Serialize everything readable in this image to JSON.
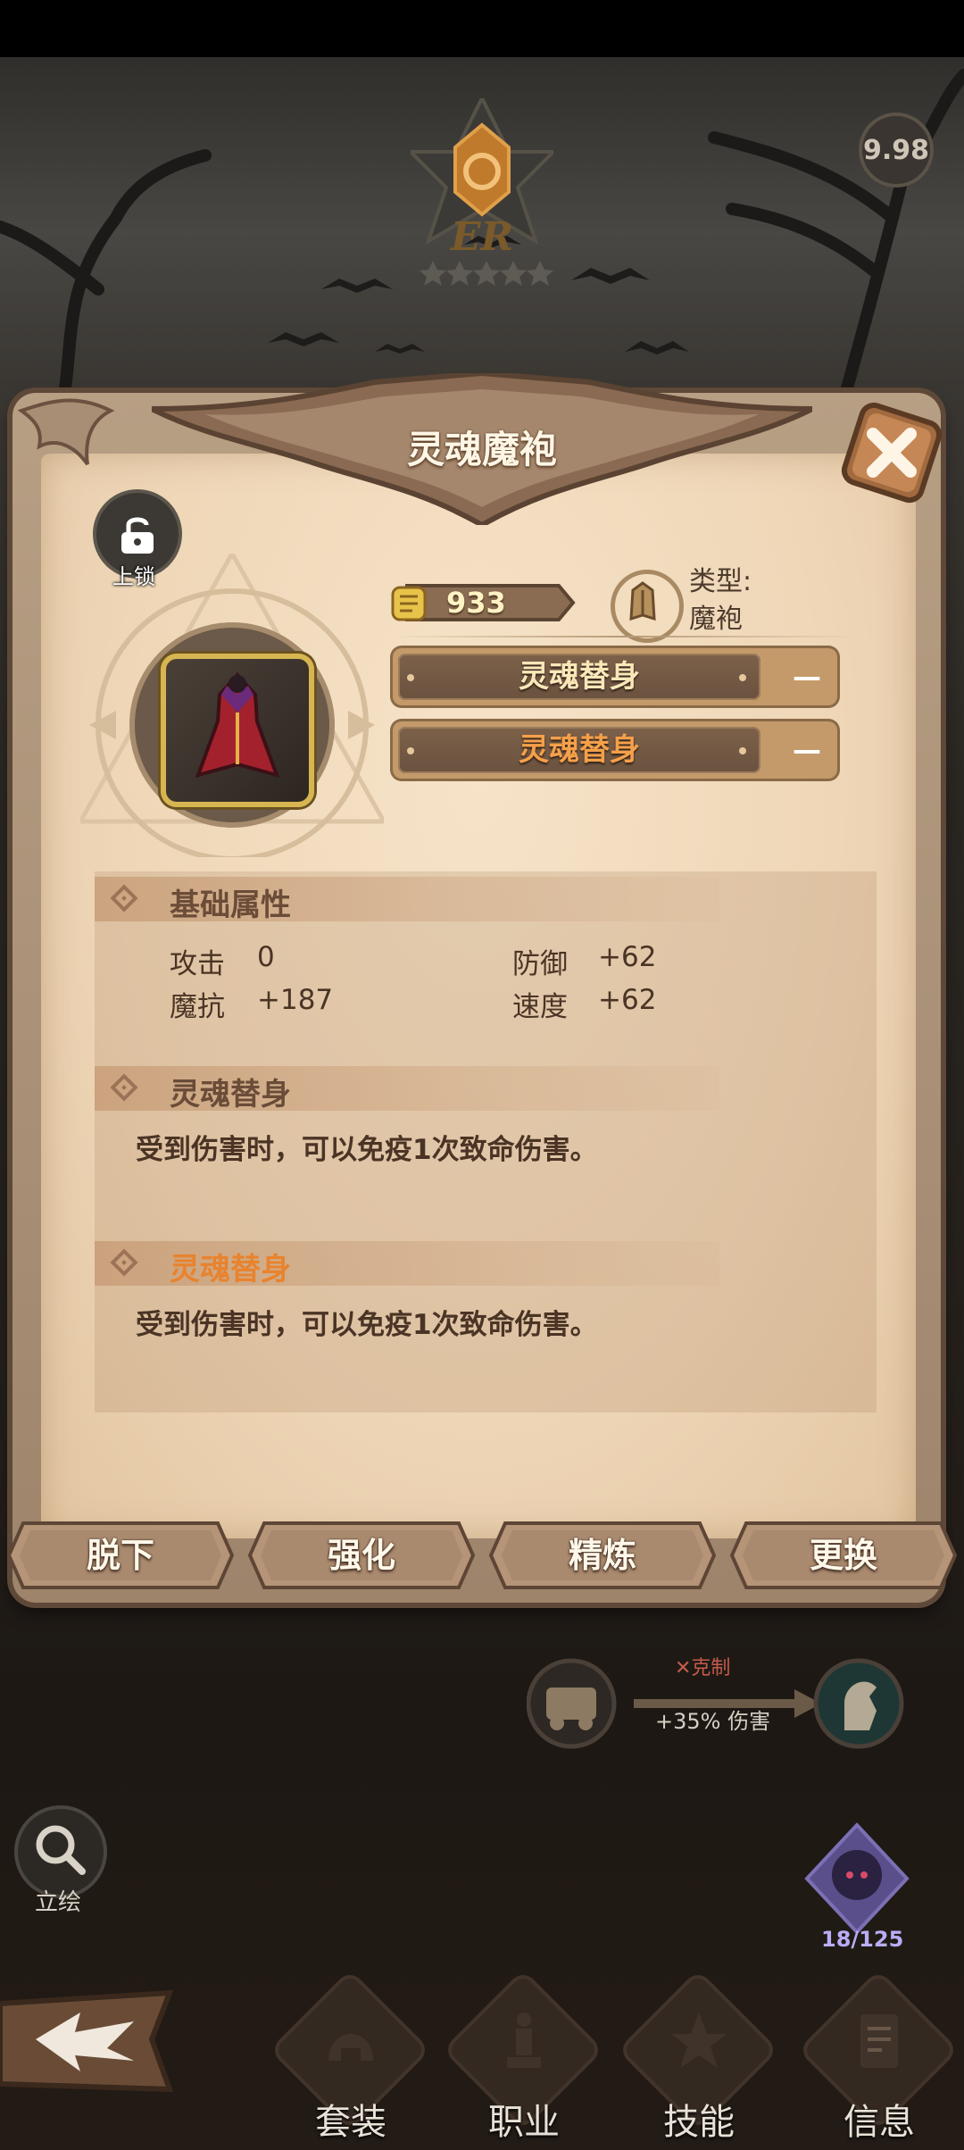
{
  "header": {
    "rank_badge": "ER",
    "score": "9.98"
  },
  "panel": {
    "title": "灵魂魔袍",
    "lock_label": "上锁",
    "power": "933",
    "type_label": "类型:",
    "type_value": "魔袍",
    "slots": [
      {
        "label": "灵魂替身",
        "value": "—",
        "color": "#f9e7b8"
      },
      {
        "label": "灵魂替身",
        "value": "—",
        "color": "#f5a04a"
      }
    ],
    "base_section": {
      "title": "基础属性",
      "stats": [
        {
          "name": "攻击",
          "value": "0"
        },
        {
          "name": "防御",
          "value": "+62"
        },
        {
          "name": "魔抗",
          "value": "+187"
        },
        {
          "name": "速度",
          "value": "+62"
        }
      ]
    },
    "effects": [
      {
        "title": "灵魂替身",
        "desc": "受到伤害时，可以免疫1次致命伤害。",
        "color": "#6a4c38"
      },
      {
        "title": "灵魂替身",
        "desc": "受到伤害时，可以免疫1次致命伤害。",
        "color": "#e8832e"
      }
    ],
    "actions": [
      "脱下",
      "强化",
      "精炼",
      "更换"
    ]
  },
  "counter": {
    "label": "✕克制",
    "bonus": "+35% 伤害"
  },
  "side": {
    "search_label": "立绘",
    "hero_count": "18/125"
  },
  "tabs": [
    "套装",
    "职业",
    "技能",
    "信息"
  ],
  "icons": {
    "lock": "lock-icon",
    "close": "close-icon",
    "search": "search-icon",
    "back": "back-arrow-icon",
    "power": "fist-icon",
    "type": "robe-icon"
  }
}
